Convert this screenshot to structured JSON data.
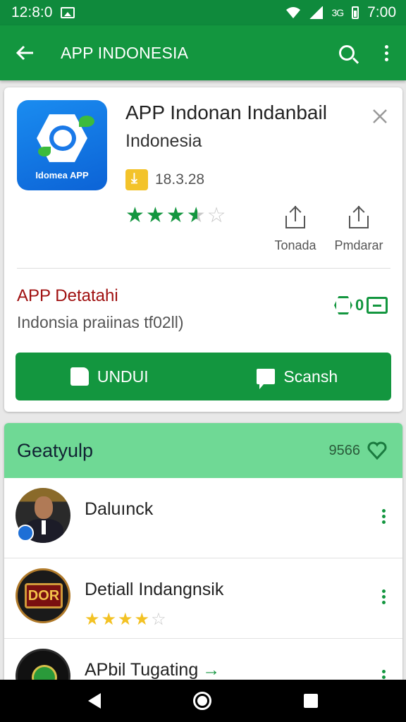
{
  "status_bar": {
    "time": "12:8:0",
    "net_label": "3G",
    "clock_right": "7:00"
  },
  "app_bar": {
    "title": "APP INDONESIA",
    "back_icon": "arrow-back-icon",
    "search_icon": "search-icon",
    "menu_icon": "more-vert-icon"
  },
  "app": {
    "icon_label": "Idomea APP",
    "name": "APP Indonan Indanbail",
    "publisher": "Indonesia",
    "downloads": "18.3.28",
    "rating": 3.5,
    "actions": [
      {
        "label": "Tonada",
        "icon": "share-icon"
      },
      {
        "label": "Pmdarar",
        "icon": "share-icon"
      }
    ]
  },
  "details": {
    "title": "APP Detatahi",
    "subtitle": "Indonsia praiinas tf02ll)",
    "badge_value": "0"
  },
  "buttons": {
    "primary_left": "UNDUI",
    "primary_right": "Scansh"
  },
  "section": {
    "title": "Geatyulp",
    "count": "9566",
    "rows": [
      {
        "title": "Daluınck",
        "rating": null
      },
      {
        "title": "Detiall Indangnsik",
        "rating": 4,
        "avatar_text": "DOR"
      },
      {
        "title": "APbil Tugating",
        "rating": null
      }
    ]
  },
  "colors": {
    "primary": "#13963f",
    "status_bar": "#0f8a3c",
    "section_header": "#6fd995",
    "star_yellow": "#f3c224",
    "details_title": "#a01010"
  }
}
